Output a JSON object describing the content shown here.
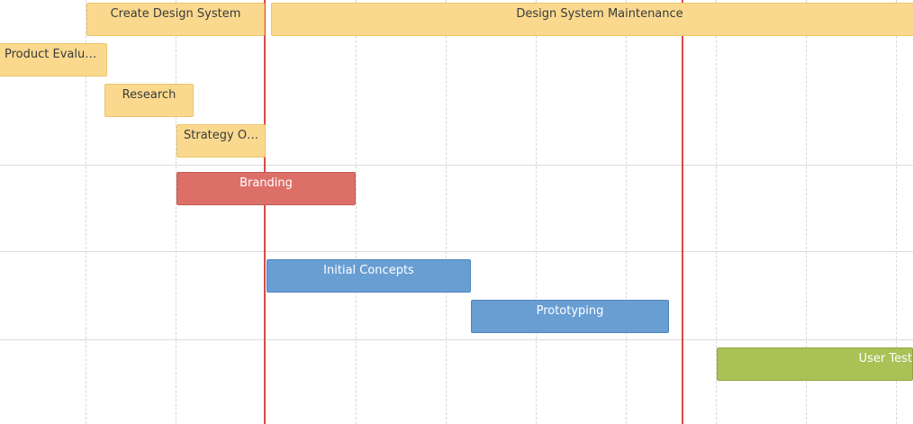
{
  "tasks": {
    "create_design_system": "Create Design System",
    "design_system_maintenance": "Design System Maintenance",
    "product_evaluation": "Product Evaluat...",
    "research": "Research",
    "strategy_overview": "Strategy Ov...",
    "branding": "Branding",
    "initial_concepts": "Initial Concepts",
    "prototyping": "Prototyping",
    "user_testing": "User Test"
  },
  "colors": {
    "design": "#fad98f",
    "branding": "#dc7069",
    "concepts": "#699ed3",
    "testing": "#a8c256",
    "today_marker": "#d84848"
  }
}
